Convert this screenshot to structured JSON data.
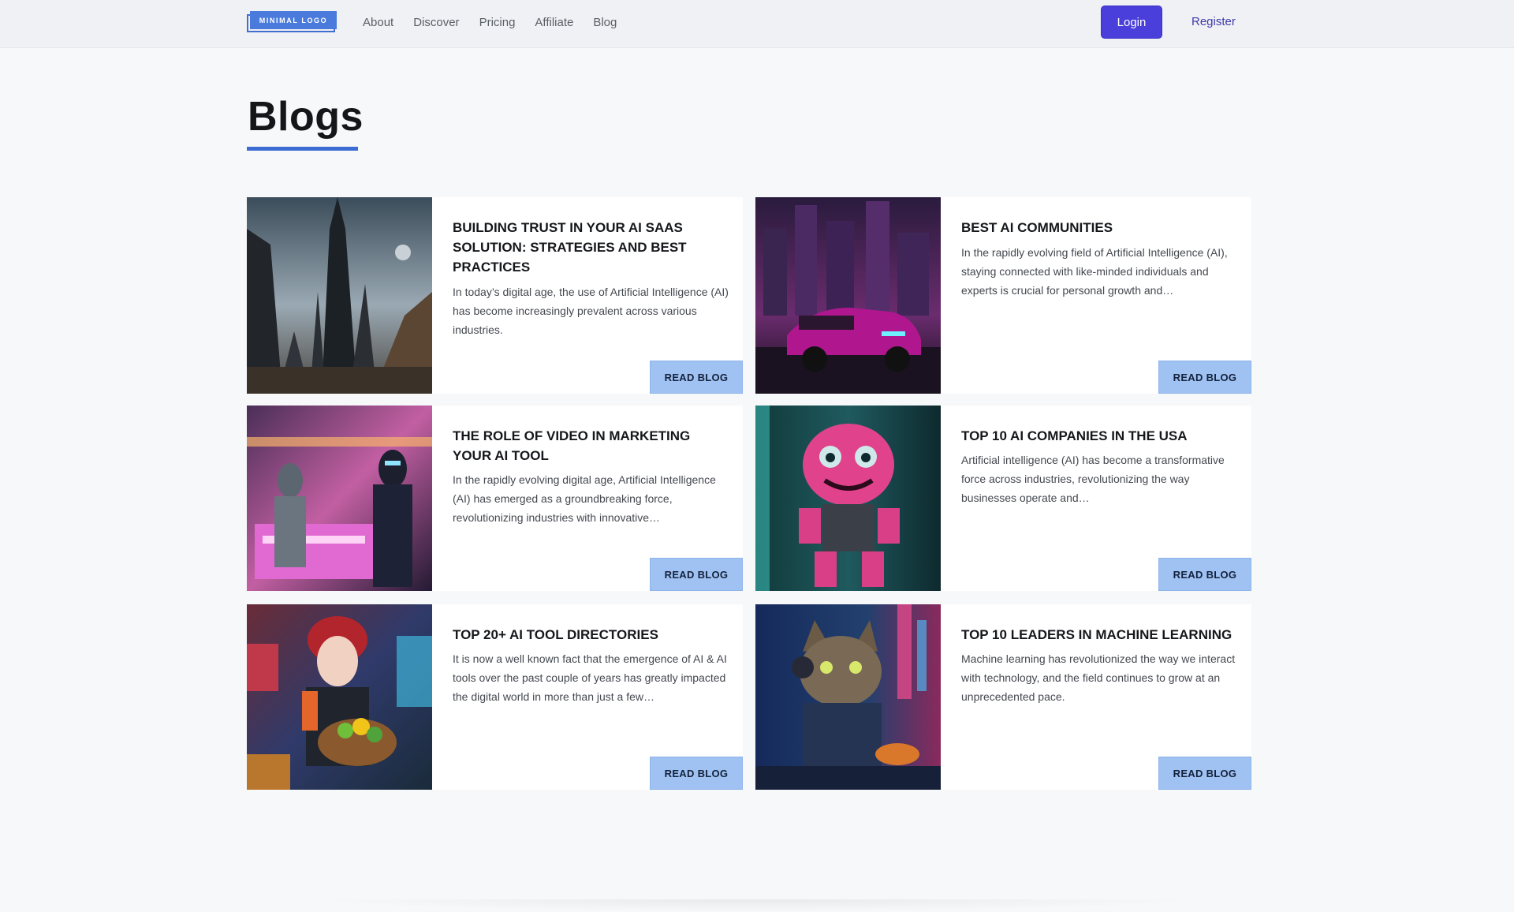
{
  "header": {
    "logo_text": "MINIMAL LOGO",
    "nav": [
      "About",
      "Discover",
      "Pricing",
      "Affiliate",
      "Blog"
    ],
    "login_label": "Login",
    "register_label": "Register"
  },
  "page": {
    "title": "Blogs"
  },
  "colors": {
    "accent": "#3d6dd3",
    "login_button": "#4a3fdb",
    "read_button": "#9fc2f2",
    "background": "#f7f8fa"
  },
  "posts": [
    {
      "title": "BUILDING TRUST IN YOUR AI SAAS SOLUTION: STRATEGIES AND BEST PRACTICES",
      "excerpt": "In today’s digital age, the use of Artificial Intelligence (AI) has become increasingly prevalent across various industries.",
      "button": "READ BLOG",
      "image": "dark-fantasy-tower-image"
    },
    {
      "title": "BEST AI COMMUNITIES",
      "excerpt": "In the rapidly evolving field of Artificial Intelligence (AI), staying connected with like-minded individuals and experts is crucial for personal growth and…",
      "button": "READ BLOG",
      "image": "neon-city-car-image"
    },
    {
      "title": "THE ROLE OF VIDEO IN MARKETING YOUR AI TOOL",
      "excerpt": "In the rapidly evolving digital age, Artificial Intelligence (AI) has emerged as a groundbreaking force, revolutionizing industries with innovative…",
      "button": "READ BLOG",
      "image": "cyberpunk-market-figures-image"
    },
    {
      "title": "TOP 10 AI COMPANIES IN THE USA",
      "excerpt": "Artificial intelligence (AI) has become a transformative force across industries, revolutionizing the way businesses operate and…",
      "button": "READ BLOG",
      "image": "pink-furry-creature-image"
    },
    {
      "title": "TOP 20+ AI TOOL DIRECTORIES",
      "excerpt": "It is now a well known fact that the emergence of AI & AI tools over the past couple of years has greatly impacted the digital world in more than just a few…",
      "button": "READ BLOG",
      "image": "red-haired-woman-vegetables-image"
    },
    {
      "title": "TOP 10 LEADERS IN MACHINE LEARNING",
      "excerpt": "Machine learning has revolutionized the way we interact with technology, and the field continues to grow at an unprecedented pace.",
      "button": "READ BLOG",
      "image": "cyber-cat-headphones-image"
    }
  ]
}
